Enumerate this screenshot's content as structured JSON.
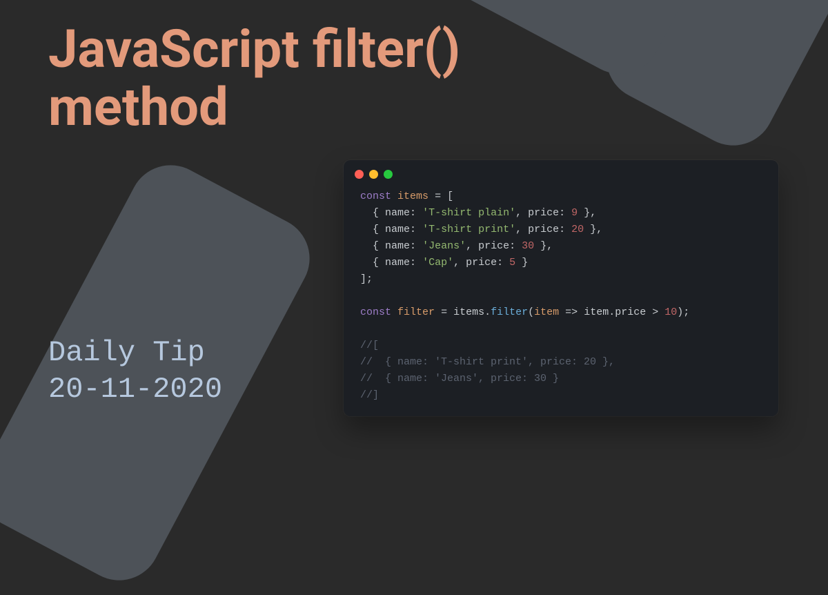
{
  "title": "JavaScript filter() method",
  "subtitle_label": "Daily Tip",
  "subtitle_date": "20-11-2020",
  "code": {
    "items_var": "items",
    "filter_var": "filter",
    "filter_call": "filter",
    "arrow_param": "item",
    "arrow_expr_obj": "item",
    "arrow_expr_prop": "price",
    "compare_num": "10",
    "items": [
      {
        "name": "T-shirt plain",
        "price": "9"
      },
      {
        "name": "T-shirt print",
        "price": "20"
      },
      {
        "name": "Jeans",
        "price": "30"
      },
      {
        "name": "Cap",
        "price": "5"
      }
    ],
    "comment_lines": [
      "//[",
      "//  { name: 'T-shirt print', price: 20 },",
      "//  { name: 'Jeans', price: 30 }",
      "//]"
    ]
  }
}
